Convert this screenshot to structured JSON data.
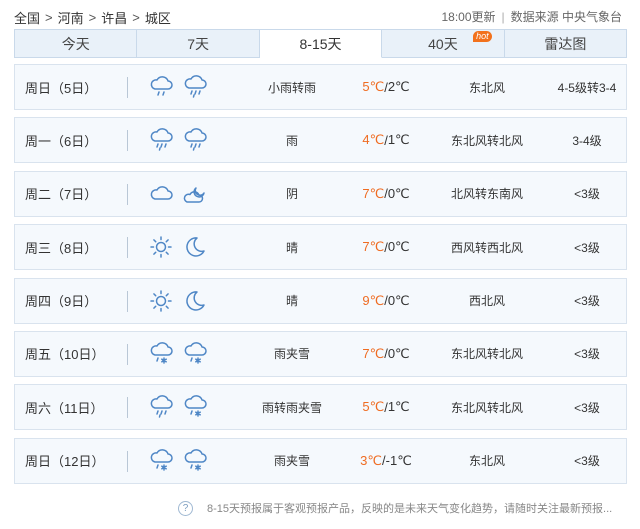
{
  "breadcrumb": [
    "全国",
    "河南",
    "许昌",
    "城区"
  ],
  "meta": {
    "updated": "18:00更新",
    "source": "数据来源 中央气象台"
  },
  "tabs": [
    {
      "label": "今天"
    },
    {
      "label": "7天"
    },
    {
      "label": "8-15天",
      "active": true
    },
    {
      "label": "40天",
      "badge": "hot"
    },
    {
      "label": "雷达图"
    }
  ],
  "days": [
    {
      "day": "周日（5日）",
      "icons": [
        "cloud-light-rain-icon",
        "cloud-rain-icon"
      ],
      "desc": "小雨转雨",
      "high": "5℃",
      "low": "2℃",
      "wind": "东北风",
      "level": "4-5级转3-4"
    },
    {
      "day": "周一（6日）",
      "icons": [
        "cloud-rain-icon",
        "cloud-rain-icon"
      ],
      "desc": "雨",
      "high": "4℃",
      "low": "1℃",
      "wind": "东北风转北风",
      "level": "3-4级"
    },
    {
      "day": "周二（7日）",
      "icons": [
        "cloud-icon",
        "cloud-moon-icon"
      ],
      "desc": "阴",
      "high": "7℃",
      "low": "0℃",
      "wind": "北风转东南风",
      "level": "<3级"
    },
    {
      "day": "周三（8日）",
      "icons": [
        "sun-icon",
        "moon-icon"
      ],
      "desc": "晴",
      "high": "7℃",
      "low": "0℃",
      "wind": "西风转西北风",
      "level": "<3级"
    },
    {
      "day": "周四（9日）",
      "icons": [
        "sun-icon",
        "moon-icon"
      ],
      "desc": "晴",
      "high": "9℃",
      "low": "0℃",
      "wind": "西北风",
      "level": "<3级"
    },
    {
      "day": "周五（10日）",
      "icons": [
        "cloud-sleet-icon",
        "cloud-sleet-icon"
      ],
      "desc": "雨夹雪",
      "high": "7℃",
      "low": "0℃",
      "wind": "东北风转北风",
      "level": "<3级"
    },
    {
      "day": "周六（11日）",
      "icons": [
        "cloud-rain-icon",
        "cloud-sleet-icon"
      ],
      "desc": "雨转雨夹雪",
      "high": "5℃",
      "low": "1℃",
      "wind": "东北风转北风",
      "level": "<3级"
    },
    {
      "day": "周日（12日）",
      "icons": [
        "cloud-sleet-icon",
        "cloud-sleet-icon"
      ],
      "desc": "雨夹雪",
      "high": "3℃",
      "low": "-1℃",
      "wind": "东北风",
      "level": "<3级"
    }
  ],
  "footer": {
    "note": "8-15天预报属于客观预报产品，反映的是未来天气变化趋势，请随时关注最新预报..."
  },
  "colors": {
    "accent_temp": "#ef6c22",
    "icon": "#4f87c6",
    "tab_bg": "#e9f1f9",
    "row_bg": "#f5f9fd"
  }
}
